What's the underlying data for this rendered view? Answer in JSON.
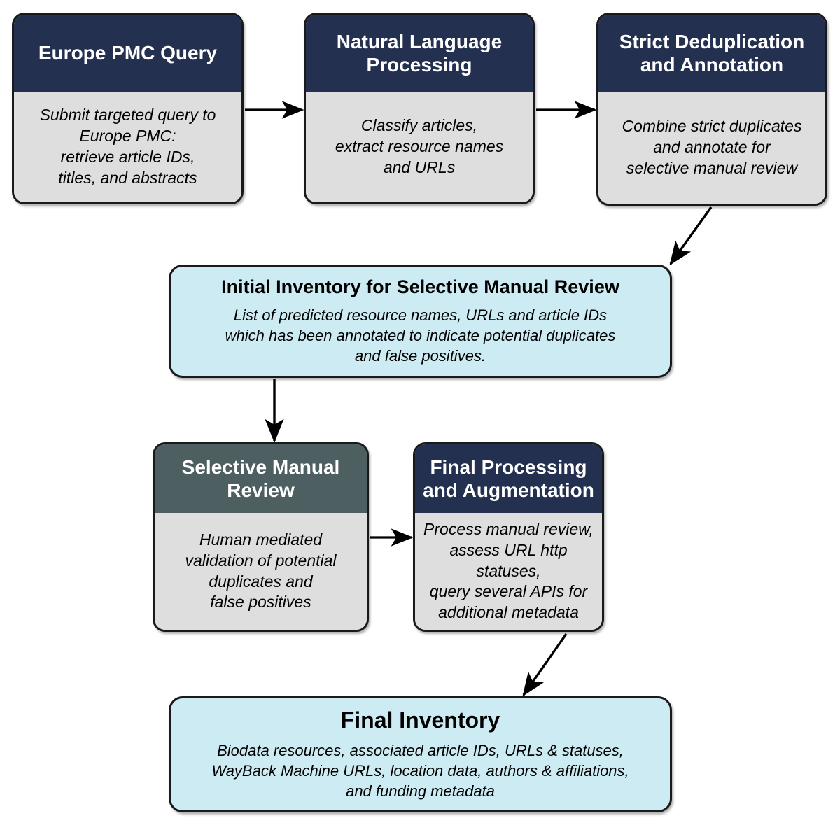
{
  "diagram": {
    "title": "Biodata resource inventory construction workflow",
    "colors": {
      "navy_header": "#23304f",
      "slate_header": "#4e5f61",
      "body_gray": "#dedede",
      "light_blue": "#cdebf2",
      "outline": "#1a1a1a",
      "header_text": "#ffffff",
      "body_text": "#000000"
    },
    "nodes": [
      {
        "id": "europe-pmc-query",
        "header": "Europe PMC Query",
        "header_style": "navy",
        "body": "Submit targeted query to\nEurope PMC:\nretrieve article IDs,\ntitles, and abstracts"
      },
      {
        "id": "natural-language-processing",
        "header": "Natural Language\nProcessing",
        "header_style": "navy",
        "body": "Classify articles,\nextract resource names\nand URLs"
      },
      {
        "id": "strict-deduplication-and-annotation",
        "header": "Strict Deduplication\nand Annotation",
        "header_style": "navy",
        "body": "Combine strict duplicates\nand annotate for\nselective manual review"
      },
      {
        "id": "initial-inventory",
        "header": "Initial Inventory for Selective Manual Review",
        "header_style": "plain-blue",
        "body": "List of predicted resource names, URLs and article IDs\nwhich has been annotated to indicate potential duplicates\nand false positives."
      },
      {
        "id": "selective-manual-review",
        "header": "Selective Manual\nReview",
        "header_style": "slate",
        "body": "Human mediated\nvalidation of potential\nduplicates and\nfalse positives"
      },
      {
        "id": "final-processing-and-augmentation",
        "header": "Final Processing\nand Augmentation",
        "header_style": "navy",
        "body": "Process manual review,\nassess URL http statuses,\nquery several APIs for\nadditional metadata"
      },
      {
        "id": "final-inventory",
        "header": "Final Inventory",
        "header_style": "plain-blue",
        "body": "Biodata resources, associated article IDs, URLs & statuses,\nWayBack Machine URLs, location data, authors & affiliations,\nand funding metadata"
      }
    ],
    "connectors": [
      {
        "id": "query-to-nlp",
        "from": "europe-pmc-query",
        "to": "natural-language-processing",
        "kind": "horizontal-arrow"
      },
      {
        "id": "nlp-to-dedup",
        "from": "natural-language-processing",
        "to": "strict-deduplication-and-annotation",
        "kind": "horizontal-arrow"
      },
      {
        "id": "dedup-to-initial-inventory",
        "from": "strict-deduplication-and-annotation",
        "to": "initial-inventory",
        "kind": "diagonal-arrow"
      },
      {
        "id": "initial-inventory-to-selective-review",
        "from": "initial-inventory",
        "to": "selective-manual-review",
        "kind": "vertical-arrow"
      },
      {
        "id": "selective-review-to-final-processing",
        "from": "selective-manual-review",
        "to": "final-processing-and-augmentation",
        "kind": "horizontal-arrow"
      },
      {
        "id": "final-processing-to-final-inventory",
        "from": "final-processing-and-augmentation",
        "to": "final-inventory",
        "kind": "diagonal-arrow"
      }
    ]
  }
}
